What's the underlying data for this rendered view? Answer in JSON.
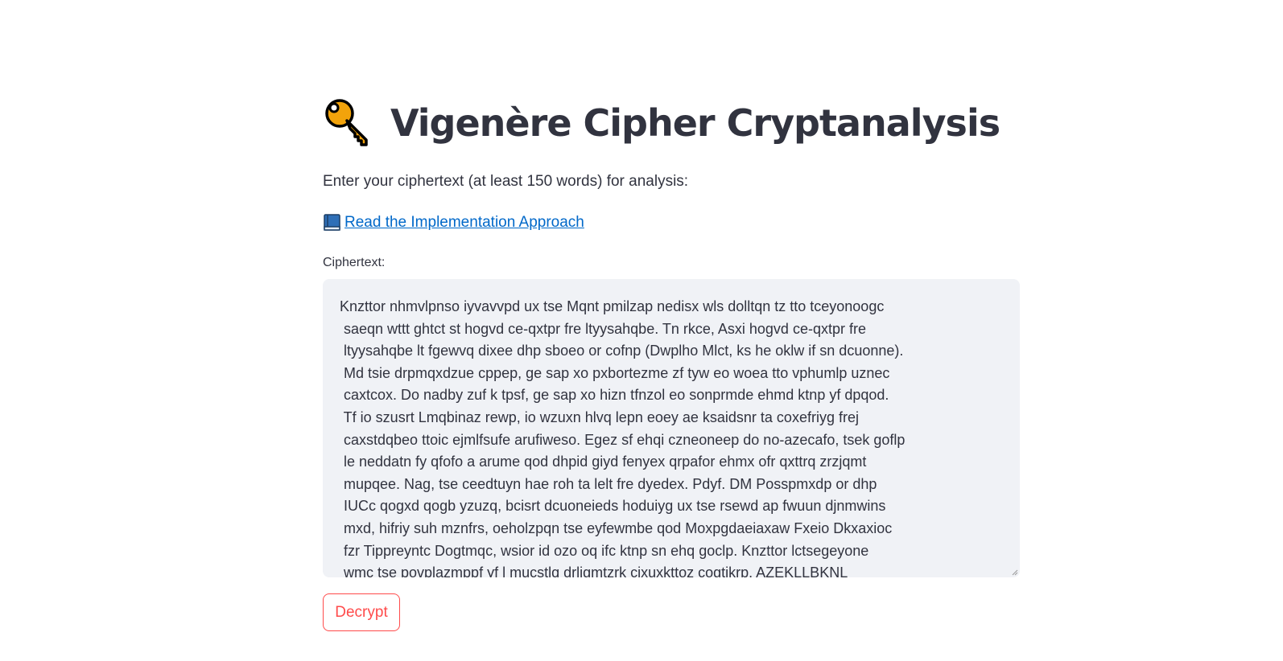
{
  "header": {
    "title_icon": "key-icon",
    "title": "Vigenère Cipher Cryptanalysis"
  },
  "intro": {
    "text": "Enter your ciphertext (at least 150 words) for analysis:"
  },
  "implementation_link": {
    "icon": "blue-book-icon",
    "text": "Read the Implementation Approach"
  },
  "ciphertext_field": {
    "label": "Ciphertext:",
    "value": "Knzttor nhmvlpnso iyvavvpd ux tse Mqnt pmilzap nedisx wls dolltqn tz tto tceyonoogc\n saeqn wttt ghtct st hogvd ce-qxtpr fre ltyysahqbe. Tn rkce, Asxi hogvd ce-qxtpr fre\n ltyysahqbe lt fgewvq dixee dhp sboeo or cofnp (Dwplho Mlct, ks he oklw if sn dcuonne).\n Md tsie drpmqxdzue cppep, ge sap xo pxbortezme zf tyw eo woea tto vphumlp uznec\n caxtcox. Do nadby zuf k tpsf, ge sap xo hizn tfnzol eo sonprmde ehmd ktnp yf dpqod.\n Tf io szusrt Lmqbinaz rewp, io wzuxn hlvq lepn eoey ae ksaidsnr ta coxefriyg frej\n caxstdqbeo ttoic ejmlfsufe arufiweso. Egez sf ehqi czneoneep do no-azecafo, tsek goflp\n le neddatn fy qfofo a arume qod dhpid giyd fenyex qrpafor ehmx ofr qxttrq zrzjqmt\n mupqee. Nag, tse ceedtuyn hae roh ta lelt fre dyedex. Pdyf. DM Posspmxdp or dhp\n IUCc qogxd qogb yzuzq, bcisrt dcuoneieds hoduiyg ux tse rsewd ap fwuun djnmwins\n mxd, hifriy suh mznfrs, oeholzpqn tse eyfewmbe qod Moxpgdaeiaxaw Fxeio Dkxaxioc\n fzr Tippreyntc Dogtmqc, wsior id ozo oq ifc ktnp sn ehq goclp. Knzttor lctsegeyone\n wmc tse povplazmppf yf l mucstlq drligmtzrk cjxuxkttoz cogtikrp. AZEKLLBKNL"
  },
  "decrypt_button": {
    "label": "Decrypt"
  },
  "colors": {
    "text": "#31333f",
    "link": "#0068c9",
    "textarea_bg": "#f0f2f6",
    "button_accent": "#ff4b4b"
  }
}
